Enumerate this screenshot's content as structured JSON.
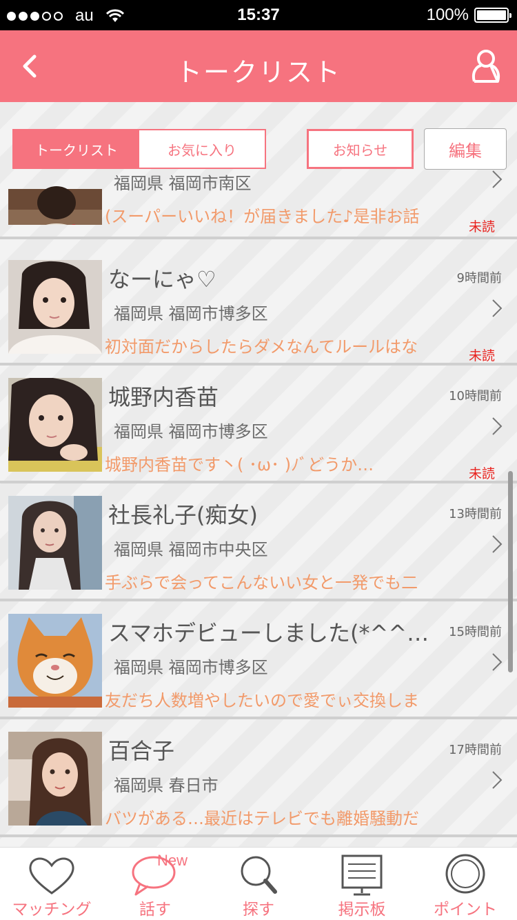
{
  "status_bar": {
    "carrier": "au",
    "time": "15:37",
    "battery": "100%"
  },
  "header": {
    "title": "トークリスト"
  },
  "tabs": [
    {
      "label": "トークリスト",
      "active": true
    },
    {
      "label": "お気に入り",
      "active": false
    }
  ],
  "buttons": {
    "notice": "お知らせ",
    "edit": "編集"
  },
  "conversations": [
    {
      "name": "",
      "time": "",
      "area": "福岡県 福岡市南区",
      "message": "(スーパーいいね！が届きました♪是非お話",
      "unread": "未読",
      "avatar": "photo-woman-yukata"
    },
    {
      "name": "なーにゃ♡",
      "time": "9時間前",
      "area": "福岡県 福岡市博多区",
      "message": "初対面だからしたらダメなんてルールはな",
      "unread": "未読",
      "avatar": "photo-woman-1"
    },
    {
      "name": "城野内香苗",
      "time": "10時間前",
      "area": "福岡県 福岡市博多区",
      "message": "城野内香苗です丶( ･ω･ )ﾉﾞどうか…",
      "unread": "未読",
      "avatar": "photo-woman-2"
    },
    {
      "name": "社長礼子(痴女)",
      "time": "13時間前",
      "area": "福岡県 福岡市中央区",
      "message": "手ぶらで会ってこんないい女と一発でも二",
      "unread": "",
      "avatar": "photo-woman-3"
    },
    {
      "name": "スマホデビューしました(*^^…",
      "time": "15時間前",
      "area": "福岡県 福岡市博多区",
      "message": "友だち人数増やしたいので愛でぃ交換しま",
      "unread": "",
      "avatar": "photo-cat"
    },
    {
      "name": "百合子",
      "time": "17時間前",
      "area": "福岡県 春日市",
      "message": "バツがある…最近はテレビでも離婚騒動だ",
      "unread": "",
      "avatar": "photo-woman-4"
    }
  ],
  "tabbar": {
    "items": [
      {
        "label": "マッチング",
        "icon": "heart-icon"
      },
      {
        "label": "話す",
        "icon": "speech-bubble-icon",
        "badge": "New"
      },
      {
        "label": "探す",
        "icon": "search-icon"
      },
      {
        "label": "掲示板",
        "icon": "board-icon"
      },
      {
        "label": "ポイント",
        "icon": "coin-icon"
      }
    ]
  },
  "colors": {
    "accent": "#f6737f",
    "message": "#f29a6a",
    "unread": "#e8231f"
  }
}
